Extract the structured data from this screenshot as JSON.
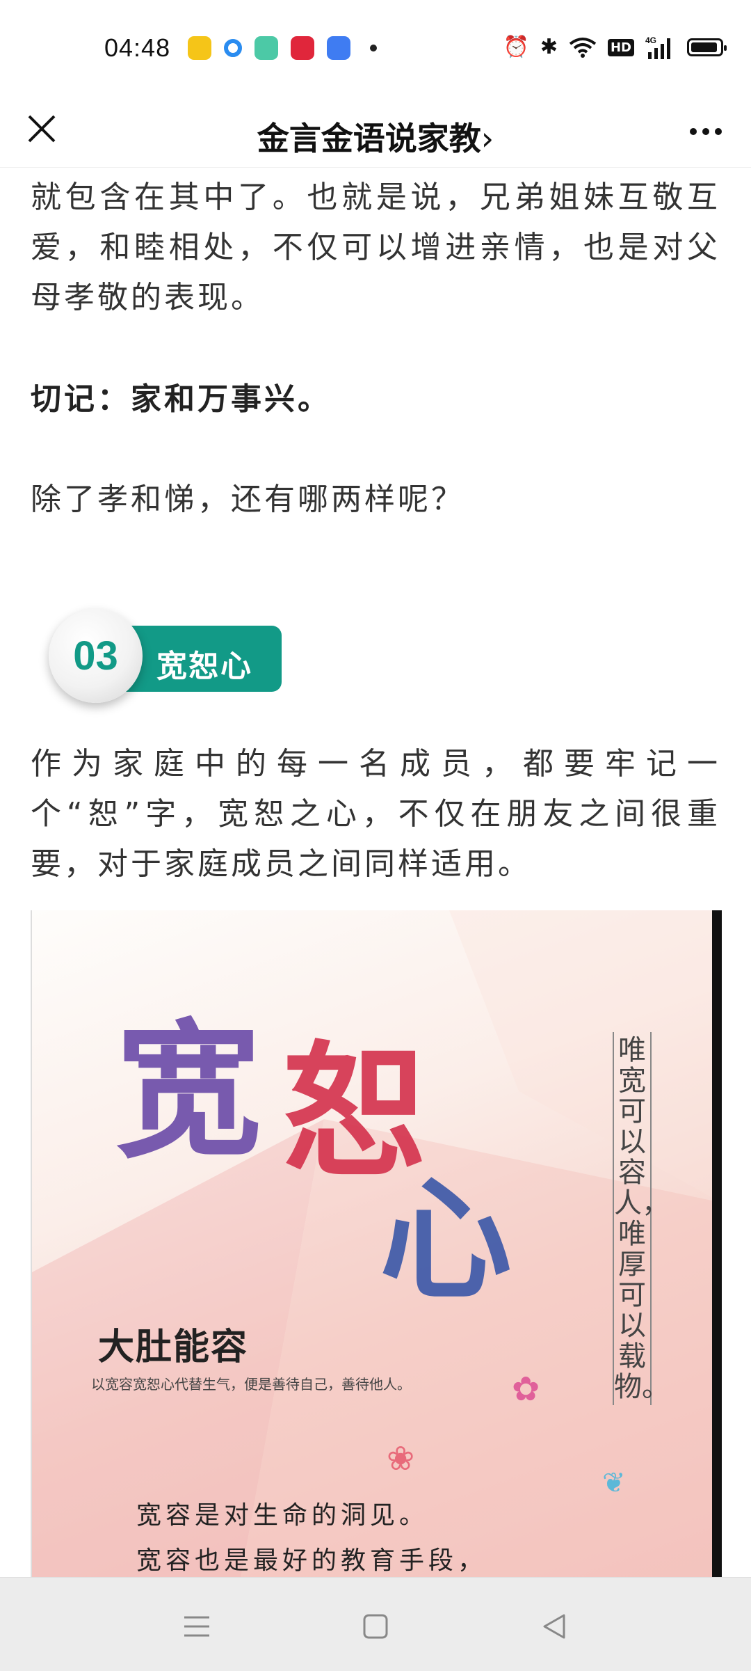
{
  "status_bar": {
    "time": "04:48",
    "network": "4G",
    "hd_label": "HD"
  },
  "nav": {
    "title": "金言金语说家教",
    "title_chevron": "›",
    "close_icon": "close-icon",
    "more_icon": "more-icon"
  },
  "article": {
    "para_top": "就包含在其中了。也就是说，兄弟姐妹互敬互爱，和睦相处，不仅可以增进亲情，也是对父母孝敬的表现。",
    "remember": "切记：家和万事兴。",
    "question": "除了孝和悌，还有哪两样呢？",
    "section": {
      "number": "03",
      "label": "宽恕心",
      "accent_color": "#129a87"
    },
    "section_para": "作为家庭中的每一名成员，都要牢记一个“恕”字，宽恕之心，不仅在朋友之间很重要，对于家庭成员之间同样适用。",
    "poster": {
      "big_char_1": "宽",
      "big_char_2": "恕",
      "big_char_3": "心",
      "vertical_quote": "唯宽可以容人，唯厚可以载物。",
      "heading": "大肚能容",
      "subheading": "以宽容宽恕心代替生气，便是善待自己，善待他人。",
      "line_1": "宽容是对生命的洞见。",
      "line_2": "宽容也是最好的教育手段，"
    }
  },
  "bottom_nav": {
    "menu_icon": "menu-icon",
    "home_icon": "home-square-icon",
    "back_icon": "back-triangle-icon"
  }
}
